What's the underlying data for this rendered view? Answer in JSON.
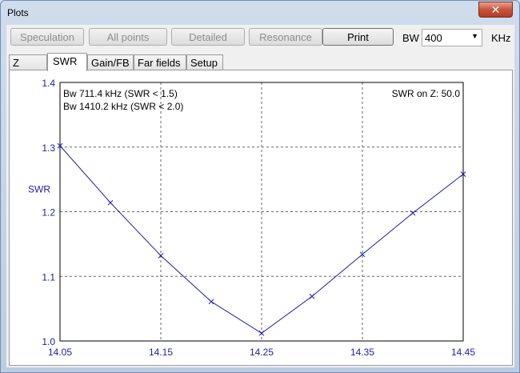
{
  "window": {
    "title": "Plots",
    "close_glyph": "✕"
  },
  "toolbar": {
    "buttons": [
      {
        "label": "Speculation",
        "enabled": false
      },
      {
        "label": "All points",
        "enabled": false
      },
      {
        "label": "Detailed",
        "enabled": false
      },
      {
        "label": "Resonance",
        "enabled": false
      },
      {
        "label": "Print",
        "enabled": true
      }
    ],
    "bw_label": "BW",
    "bw_value": "400",
    "bw_unit": "KHz"
  },
  "tabs": [
    {
      "label": "Z",
      "active": false
    },
    {
      "label": "SWR",
      "active": true
    },
    {
      "label": "Gain/FB",
      "active": false
    },
    {
      "label": "Far fields",
      "active": false
    },
    {
      "label": "Setup",
      "active": false
    }
  ],
  "chart_data": {
    "type": "line",
    "ylabel": "SWR",
    "xlim": [
      14.05,
      14.45
    ],
    "ylim": [
      1.0,
      1.4
    ],
    "x_ticks": [
      "14.05",
      "14.15",
      "14.25",
      "14.35",
      "14.45"
    ],
    "y_ticks": [
      "1.0",
      "1.1",
      "1.2",
      "1.3",
      "1.4"
    ],
    "grid": true,
    "annotations": {
      "bw1": "Bw 711.4 kHz (SWR < 1.5)",
      "bw2": "Bw 1410.2 kHz (SWR < 2.0)",
      "swr_on_z": "SWR on Z: 50.0"
    },
    "series": [
      {
        "x": [
          14.05,
          14.1,
          14.15,
          14.2,
          14.25,
          14.3,
          14.35,
          14.4,
          14.45
        ],
        "y": [
          1.302,
          1.214,
          1.132,
          1.061,
          1.012,
          1.069,
          1.134,
          1.198,
          1.258
        ],
        "color": "#1c1caa"
      }
    ]
  }
}
